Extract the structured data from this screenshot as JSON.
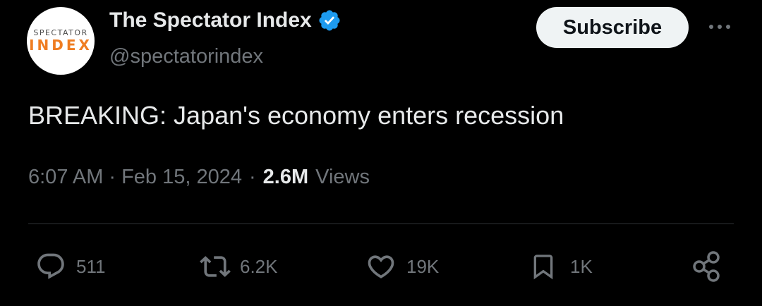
{
  "author": {
    "logo_top": "SPECTATOR",
    "logo_bottom": "INDEX",
    "name": "The Spectator Index",
    "handle": "@spectatorindex",
    "verified_color": "#1d9bf0"
  },
  "subscribe_label": "Subscribe",
  "more_icon": "ellipsis-icon",
  "tweet": {
    "text": "BREAKING: Japan's economy enters recession",
    "time": "6:07 AM",
    "sep1": "·",
    "date": "Feb 15, 2024",
    "sep2": "·",
    "views_count": "2.6M",
    "views_label": "Views"
  },
  "actions": {
    "reply": {
      "icon": "reply-icon",
      "count": "511"
    },
    "retweet": {
      "icon": "retweet-icon",
      "count": "6.2K"
    },
    "like": {
      "icon": "heart-icon",
      "count": "19K"
    },
    "bookmark": {
      "icon": "bookmark-icon",
      "count": "1K"
    },
    "share": {
      "icon": "share-icon"
    }
  },
  "colors": {
    "background": "#000000",
    "text_primary": "#e7e9ea",
    "text_secondary": "#71767b",
    "divider": "#2f3336",
    "logo_accent": "#ef7d22"
  }
}
